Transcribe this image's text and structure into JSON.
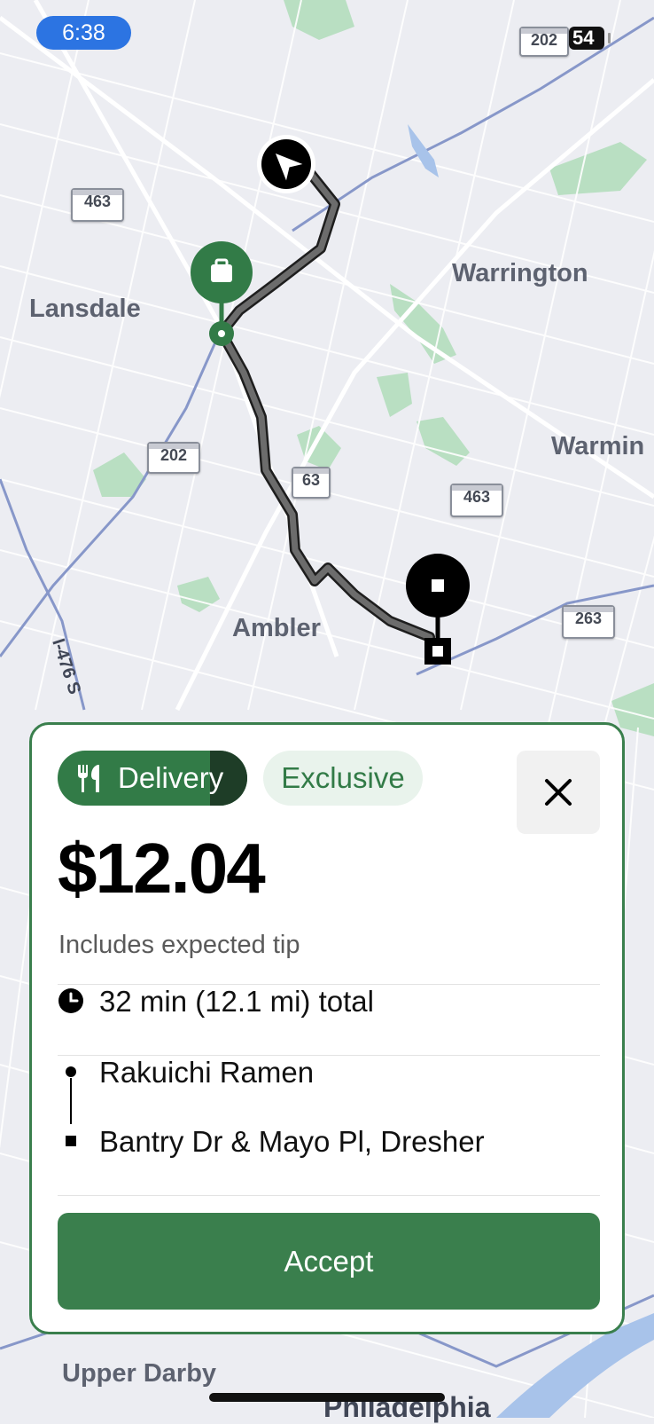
{
  "status_bar": {
    "time": "6:38",
    "battery": "54"
  },
  "map": {
    "places": [
      "Lansdale",
      "Warrington",
      "Warmin",
      "Ambler",
      "Upper Darby",
      "Philadelphia",
      "I-476 S"
    ],
    "route_shields": [
      "202",
      "463",
      "202",
      "63",
      "463",
      "263",
      "202"
    ]
  },
  "offer": {
    "type_label": "Delivery",
    "badge_label": "Exclusive",
    "price": "$12.04",
    "price_note": "Includes expected tip",
    "trip_summary": "32 min (12.1 mi) total",
    "pickup": "Rakuichi Ramen",
    "dropoff": "Bantry Dr & Mayo Pl, Dresher",
    "accept_label": "Accept"
  },
  "colors": {
    "accent": "#3a7f4d",
    "route": "#5f5f5f",
    "map_bg": "#ecedf2"
  },
  "icons": [
    "navigation-arrow-icon",
    "restaurant-bag-icon",
    "fork-knife-icon",
    "close-icon",
    "clock-icon"
  ]
}
